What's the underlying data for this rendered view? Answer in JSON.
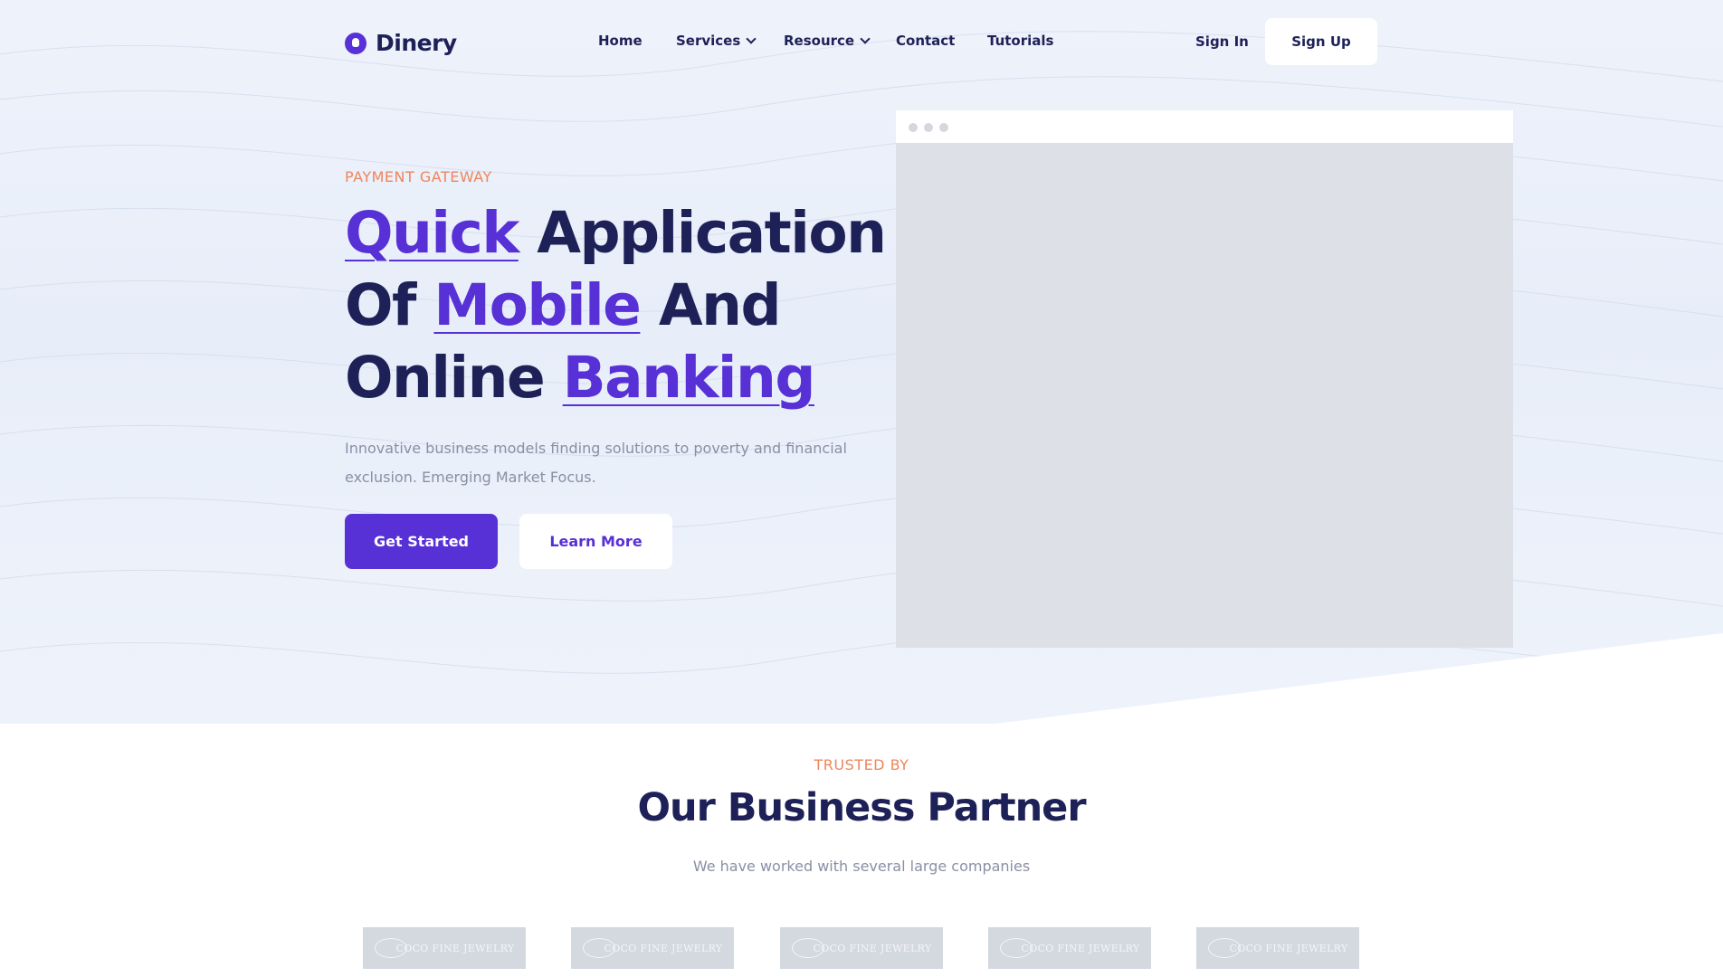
{
  "brand": {
    "name": "Dinery",
    "accent": "#5730d6",
    "highlight": "#f0855a",
    "dark": "#1e2157"
  },
  "nav": {
    "items": [
      {
        "label": "Home",
        "has_dropdown": false
      },
      {
        "label": "Services",
        "has_dropdown": true
      },
      {
        "label": "Resource",
        "has_dropdown": true
      },
      {
        "label": "Contact",
        "has_dropdown": false
      },
      {
        "label": "Tutorials",
        "has_dropdown": false
      }
    ],
    "sign_in": "Sign In",
    "sign_up": "Sign Up"
  },
  "hero": {
    "kicker": "PAYMENT GATEWAY",
    "headline": {
      "w1": "Quick",
      "w2": "Application",
      "w3": "Of",
      "w4": "Mobile",
      "w5": "And",
      "w6": "Online",
      "w7": "Banking"
    },
    "description": "Innovative business models finding solutions to poverty and financial exclusion. Emerging Market Focus.",
    "primary_cta": "Get Started",
    "secondary_cta": "Learn More"
  },
  "partners": {
    "kicker": "TRUSTED BY",
    "title": "Our Business Partner",
    "subtitle": "We have worked with several large companies",
    "logos": [
      "COCO FINE JEWELRY",
      "COCO FINE JEWELRY",
      "COCO FINE JEWELRY",
      "COCO FINE JEWELRY",
      "COCO FINE JEWELRY"
    ]
  }
}
